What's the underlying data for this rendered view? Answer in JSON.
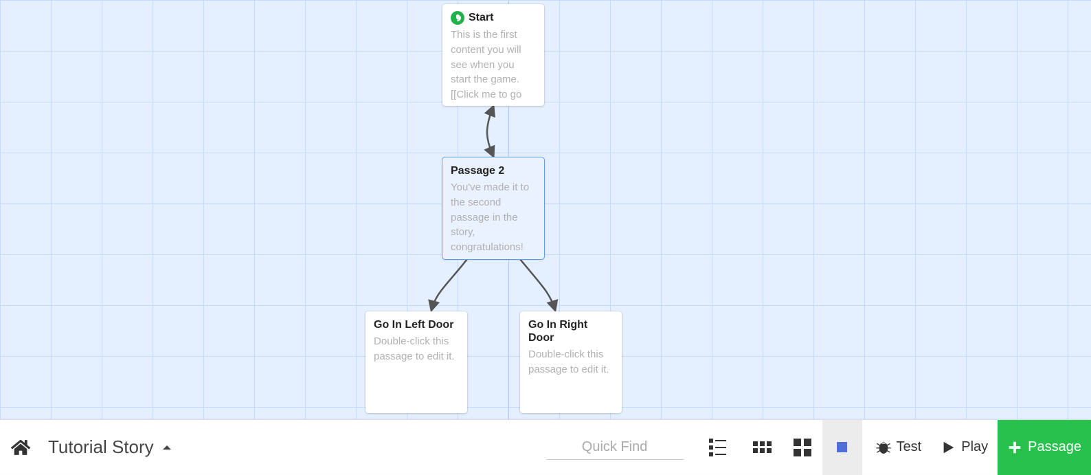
{
  "story_title": "Tutorial Story",
  "passages": {
    "start": {
      "title": "Start",
      "body": "This is the first content you will see when you start the game. [[Click me to go"
    },
    "p2": {
      "title": "Passage 2",
      "body": "You've made it to the second passage in the story, congratulations!"
    },
    "left": {
      "title": "Go In Left Door",
      "body": "Double-click this passage to edit it."
    },
    "right": {
      "title": "Go In Right Door",
      "body": "Double-click this passage to edit it."
    }
  },
  "toolbar": {
    "quick_find_placeholder": "Quick Find",
    "test_label": "Test",
    "play_label": "Play",
    "passage_label": "Passage"
  }
}
